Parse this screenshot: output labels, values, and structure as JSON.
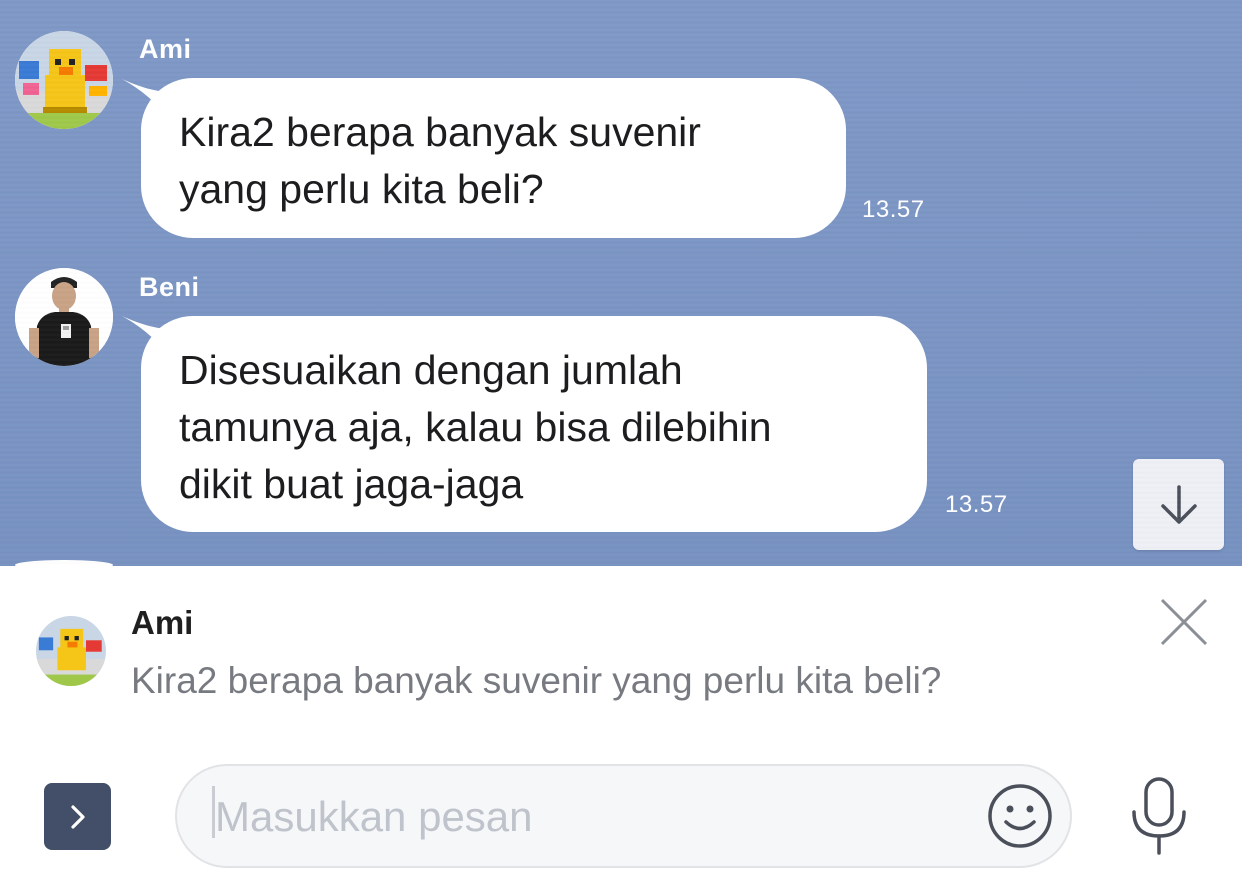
{
  "messages": [
    {
      "sender": "Ami",
      "lines": [
        "Kira2 berapa banyak suvenir",
        "yang perlu kita beli?"
      ],
      "time": "13.57",
      "avatar": "duck-avatar"
    },
    {
      "sender": "Beni",
      "lines": [
        "Disesuaikan dengan jumlah",
        "tamunya aja, kalau bisa dilebihin",
        "dikit buat jaga-jaga"
      ],
      "time": "13.57",
      "avatar": "man-avatar"
    }
  ],
  "reply_preview": {
    "sender": "Ami",
    "text": "Kira2 berapa banyak suvenir yang perlu kita beli?"
  },
  "input": {
    "placeholder": "Masukkan pesan",
    "value": ""
  },
  "icons": {
    "scroll_down": "arrow-down-icon",
    "close": "close-icon",
    "expand": "chevron-right-icon",
    "emoji": "smiley-icon",
    "mic": "microphone-icon"
  },
  "colors": {
    "chat_background": "#7b95c4",
    "bubble": "#ffffff",
    "expand_button": "#434e68",
    "placeholder": "#bfc3cb"
  }
}
